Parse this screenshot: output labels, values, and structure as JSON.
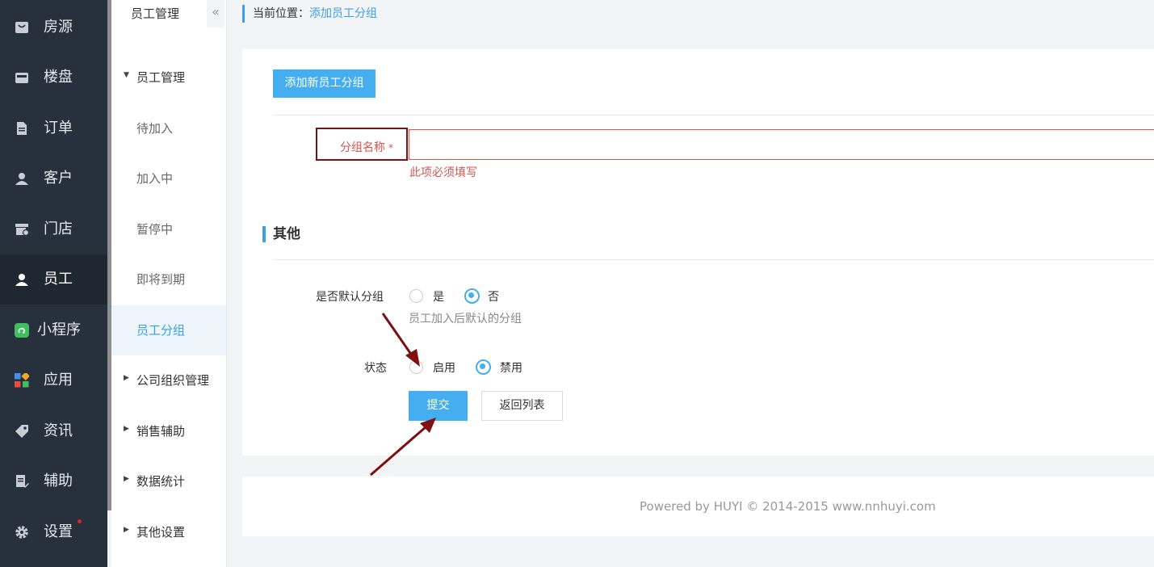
{
  "nav": {
    "items": [
      {
        "label": "房源",
        "icon": "bag-icon"
      },
      {
        "label": "楼盘",
        "icon": "building-icon"
      },
      {
        "label": "订单",
        "icon": "document-icon"
      },
      {
        "label": "客户",
        "icon": "user-icon"
      },
      {
        "label": "门店",
        "icon": "store-icon"
      },
      {
        "label": "员工",
        "icon": "user-icon",
        "active": true
      },
      {
        "label": "小程序",
        "icon": "mini-program-icon"
      },
      {
        "label": "应用",
        "icon": "apps-icon"
      },
      {
        "label": "资讯",
        "icon": "tag-icon"
      },
      {
        "label": "辅助",
        "icon": "edit-doc-icon"
      },
      {
        "label": "设置",
        "icon": "gear-icon",
        "badge": true
      }
    ]
  },
  "subnav": {
    "title": "员工管理",
    "collapse_icon": "«",
    "items": [
      {
        "label": "员工管理",
        "type": "group-open"
      },
      {
        "label": "待加入"
      },
      {
        "label": "加入中"
      },
      {
        "label": "暂停中"
      },
      {
        "label": "即将到期"
      },
      {
        "label": "员工分组",
        "active": true
      },
      {
        "label": "公司组织管理",
        "type": "group"
      },
      {
        "label": "销售辅助",
        "type": "group"
      },
      {
        "label": "数据统计",
        "type": "group"
      },
      {
        "label": "其他设置",
        "type": "group"
      }
    ]
  },
  "breadcrumb": {
    "prefix": "当前位置：",
    "current": "添加员工分组"
  },
  "form": {
    "add_button": "添加新员工分组",
    "group_name_label": "分组名称",
    "required_mark": "*",
    "group_name_value": "",
    "error_text": "此项必须填写",
    "section_title": "其他",
    "default_label": "是否默认分组",
    "default_yes": "是",
    "default_no": "否",
    "default_selected": "否",
    "default_help": "员工加入后默认的分组",
    "status_label": "状态",
    "status_on": "启用",
    "status_off": "禁用",
    "status_selected": "禁用",
    "submit": "提交",
    "back": "返回列表"
  },
  "footer": "Powered by HUYI © 2014-2015 www.nnhuyi.com",
  "colors": {
    "accent": "#45aef0",
    "sidebar": "#27313d",
    "error": "#d9534f",
    "annotation": "#7d1010"
  }
}
